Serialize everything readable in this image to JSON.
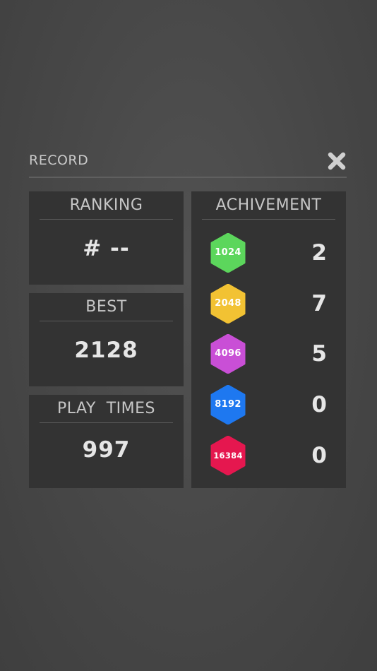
{
  "header": {
    "title": "RECORD",
    "close_icon": "close-x-icon"
  },
  "ranking": {
    "title": "RANKING",
    "value": "# --"
  },
  "best": {
    "title": "BEST",
    "value": "2128"
  },
  "play_times": {
    "title": "PLAY  TIMES",
    "value": "997"
  },
  "achievement": {
    "title": "ACHIVEMENT",
    "items": [
      {
        "tile": "1024",
        "count": "2",
        "color": "#5cd65c"
      },
      {
        "tile": "2048",
        "count": "7",
        "color": "#f2c233"
      },
      {
        "tile": "4096",
        "count": "5",
        "color": "#c94fd6"
      },
      {
        "tile": "8192",
        "count": "0",
        "color": "#1e78f0"
      },
      {
        "tile": "16384",
        "count": "0",
        "color": "#e5174f"
      }
    ]
  }
}
